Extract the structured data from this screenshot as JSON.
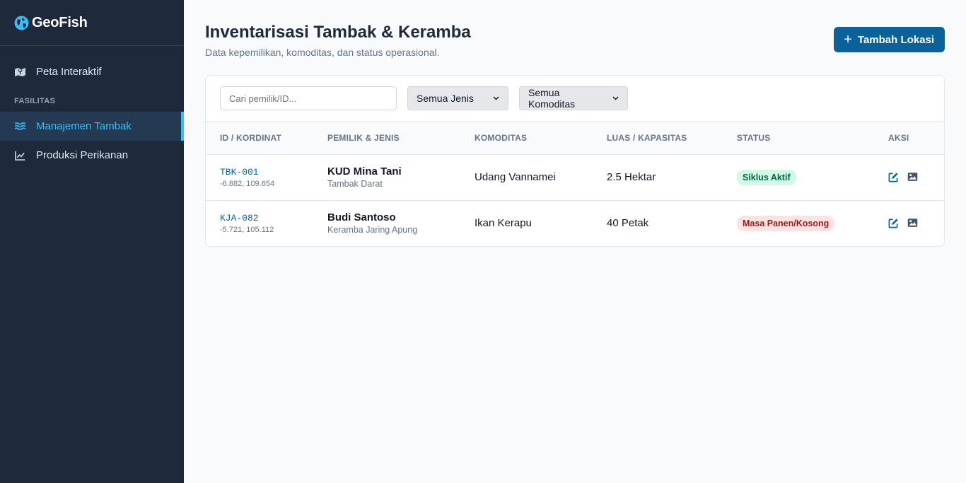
{
  "brand": {
    "name": "GeoFish",
    "icon": "globe-icon"
  },
  "sidebar": {
    "items_top": [
      {
        "label": "Peta Interaktif",
        "icon": "map-icon"
      }
    ],
    "section_label": "FASILITAS",
    "items": [
      {
        "label": "Manajemen Tambak",
        "icon": "water-icon",
        "active": true
      },
      {
        "label": "Produksi Perikanan",
        "icon": "chart-line-icon",
        "active": false
      }
    ]
  },
  "header": {
    "title": "Inventarisasi Tambak & Keramba",
    "subtitle": "Data kepemilikan, komoditas, dan status operasional.",
    "add_button": "Tambah Lokasi"
  },
  "filters": {
    "search_placeholder": "Cari pemilik/ID...",
    "jenis_selected": "Semua Jenis",
    "komoditas_selected": "Semua Komoditas"
  },
  "table": {
    "columns": [
      "ID / KORDINAT",
      "PEMILIK & JENIS",
      "KOMODITAS",
      "LUAS / KAPASITAS",
      "STATUS",
      "AKSI"
    ],
    "rows": [
      {
        "id": "TBK-001",
        "coord": "-6.882, 109.654",
        "owner": "KUD Mina Tani",
        "type": "Tambak Darat",
        "komoditas": "Udang Vannamei",
        "luas": "2.5 Hektar",
        "status": "Siklus Aktif",
        "status_color": "#065f46"
      },
      {
        "id": "KJA-082",
        "coord": "-5.721, 105.112",
        "owner": "Budi Santoso",
        "type": "Keramba Jaring Apung",
        "komoditas": "Ikan Kerapu",
        "luas": "40 Petak",
        "status": "Masa Panen/Kosong",
        "status_color": "#991b1b"
      }
    ]
  },
  "colors": {
    "accent": "#0b6199",
    "sidebar_bg": "#1e293b",
    "active_nav": "#38bdf8"
  }
}
